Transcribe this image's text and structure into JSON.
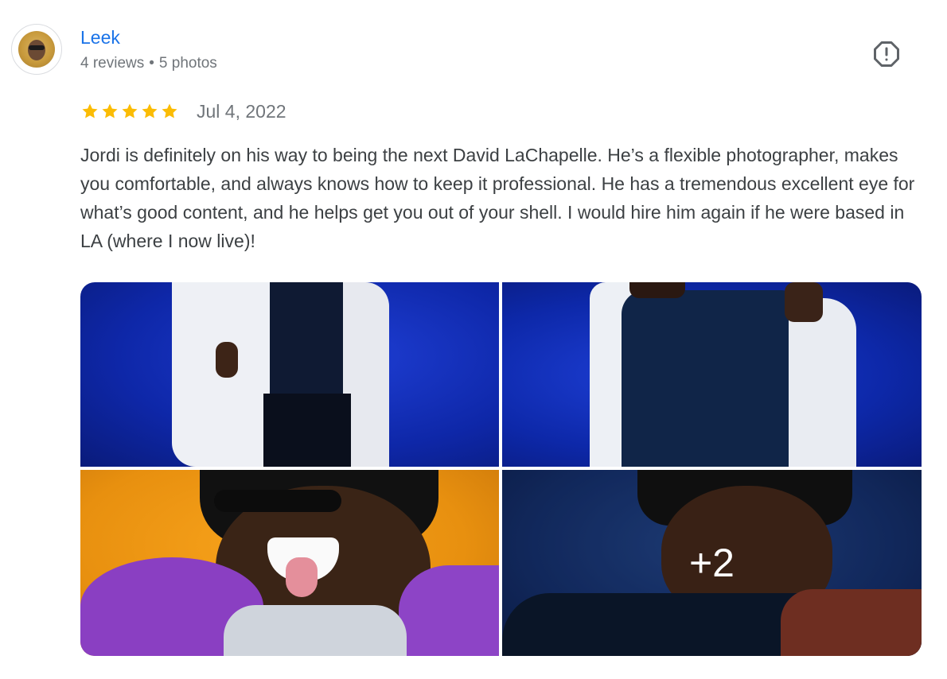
{
  "reviewer": {
    "name": "Leek",
    "reviews": "4 reviews",
    "separator": "•",
    "photos": "5 photos"
  },
  "review": {
    "rating": 5,
    "max_rating": 5,
    "date": "Jul 4, 2022",
    "text": "Jordi is definitely on his way to being the next David LaChapelle. He’s a flexible photographer, makes you comfortable, and always knows how to keep it professional. He has a tremendous excellent eye for what’s good content, and he helps get you out of your shell. I would hire him again if he were based in LA (where I now live)!"
  },
  "photos": {
    "more_count": "+2"
  },
  "colors": {
    "name_link": "#1a73e8",
    "star": "#fbbc04",
    "meta_text": "#70757a",
    "body_text": "#3c4043"
  },
  "icons": {
    "report": "report-flag-icon",
    "star": "star-icon"
  }
}
